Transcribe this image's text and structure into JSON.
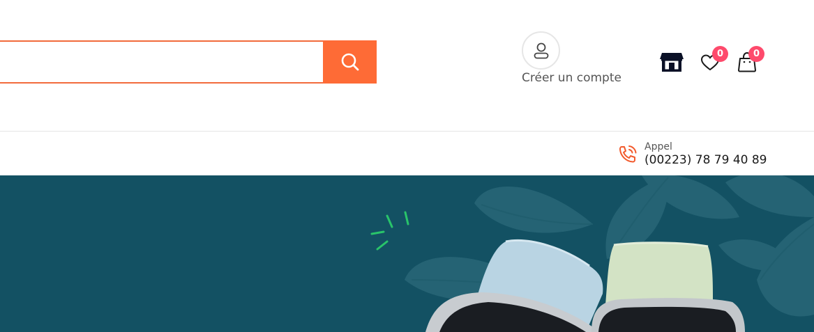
{
  "search": {
    "placeholder": "",
    "value": ""
  },
  "account": {
    "label": "Créer un compte"
  },
  "wishlist": {
    "count": "0"
  },
  "cart": {
    "count": "0"
  },
  "call": {
    "label": "Appel",
    "number": "(00223) 78 79 40 89"
  },
  "colors": {
    "accent": "#fe6b36",
    "badge": "#fe4a6c",
    "hero_background": "#135163",
    "watch_band_left": "#b8d3e2",
    "watch_band_right": "#d3e2c4",
    "sparkle": "#29c46a"
  },
  "icons": {
    "search": "search-icon",
    "account": "user-icon",
    "store": "store-icon",
    "wishlist": "heart-icon",
    "cart": "bag-icon",
    "call": "phone-icon"
  }
}
